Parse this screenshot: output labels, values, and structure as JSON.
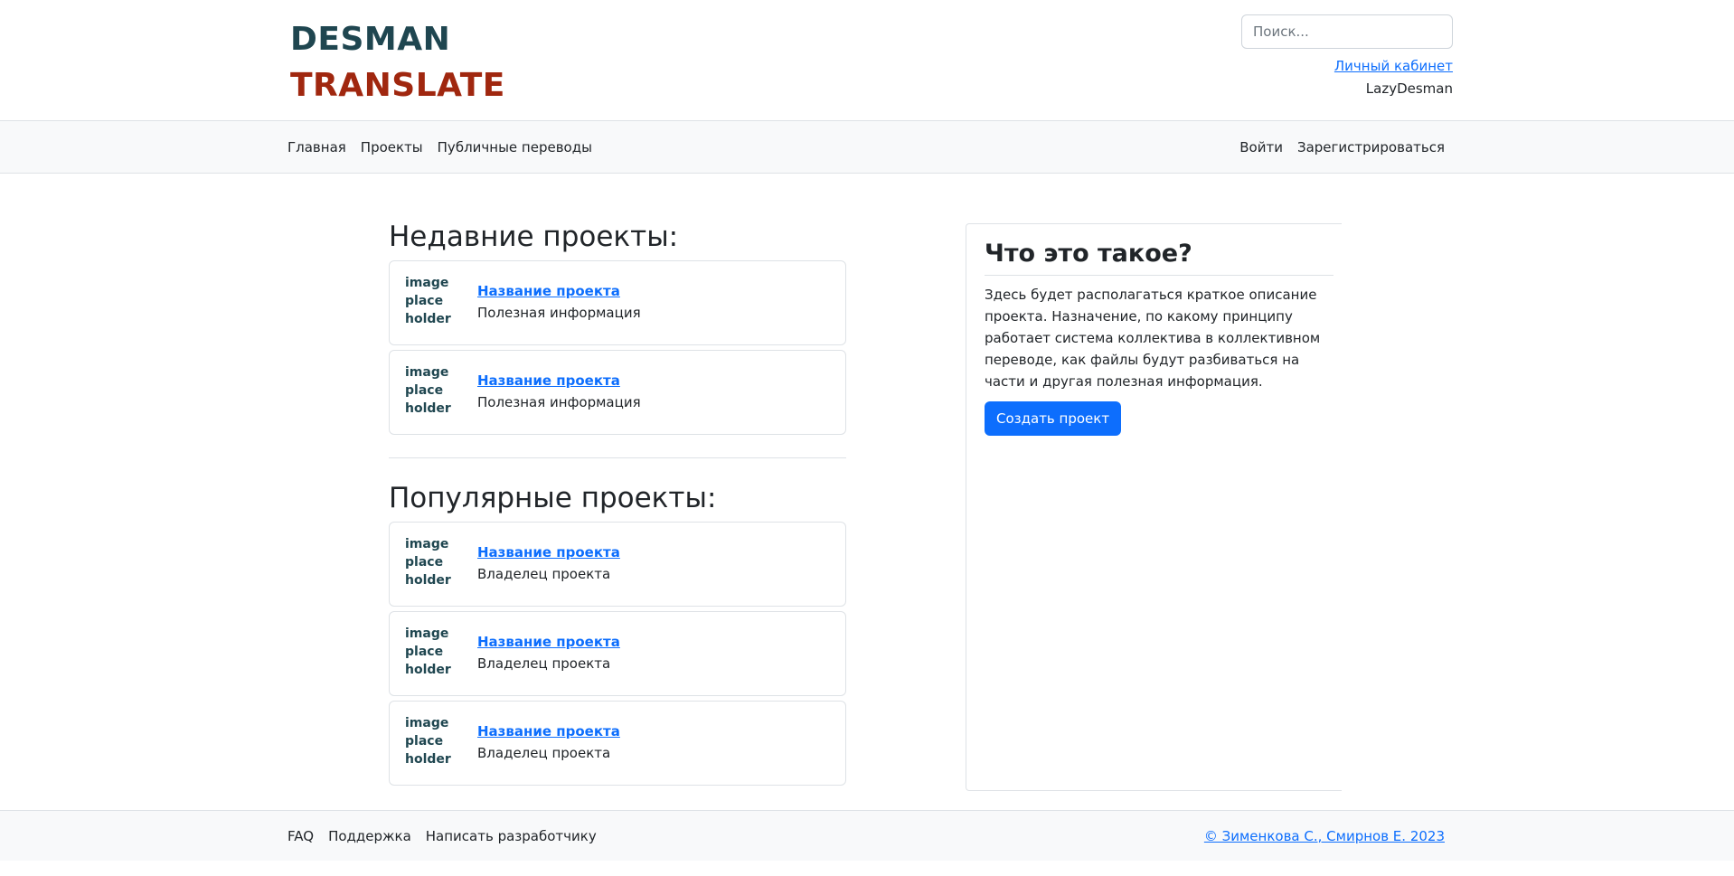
{
  "header": {
    "logo_line1": "DESMAN",
    "logo_line2": "TRANSLATE",
    "search_placeholder": "Поиск...",
    "cabinet_link": "Личный кабинет",
    "username": "LazyDesman"
  },
  "navbar": {
    "left": [
      "Главная",
      "Проекты",
      "Публичные переводы"
    ],
    "right": [
      "Войти",
      "Зарегистрироваться"
    ]
  },
  "recent": {
    "title": "Недавние проекты:",
    "items": [
      {
        "image": "image place holder",
        "title": "Название проекта",
        "subtitle": "Полезная информация"
      },
      {
        "image": "image place holder",
        "title": "Название проекта",
        "subtitle": "Полезная информация"
      }
    ]
  },
  "popular": {
    "title": "Популярные проекты:",
    "items": [
      {
        "image": "image place holder",
        "title": "Название проекта",
        "subtitle": "Владелец проекта"
      },
      {
        "image": "image place holder",
        "title": "Название проекта",
        "subtitle": "Владелец проекта"
      },
      {
        "image": "image place holder",
        "title": "Название проекта",
        "subtitle": "Владелец проекта"
      }
    ]
  },
  "aside": {
    "title": "Что это такое?",
    "description": "Здесь будет располагаться краткое описание проекта. Назначение, по какому принципу работает система коллектива в коллективном переводе, как файлы будут разбиваться на части и другая полезная информация.",
    "button": "Создать проект"
  },
  "footer": {
    "links": [
      "FAQ",
      "Поддержка",
      "Написать разработчику"
    ],
    "copyright": "© Зименкова С., Смирнов Е. 2023"
  },
  "colors": {
    "logo_dark": "#1f4650",
    "logo_red": "#a0270f",
    "link": "#0d6efd",
    "primary_button": "#0d6efd",
    "bar_bg": "#f8f9fa"
  }
}
